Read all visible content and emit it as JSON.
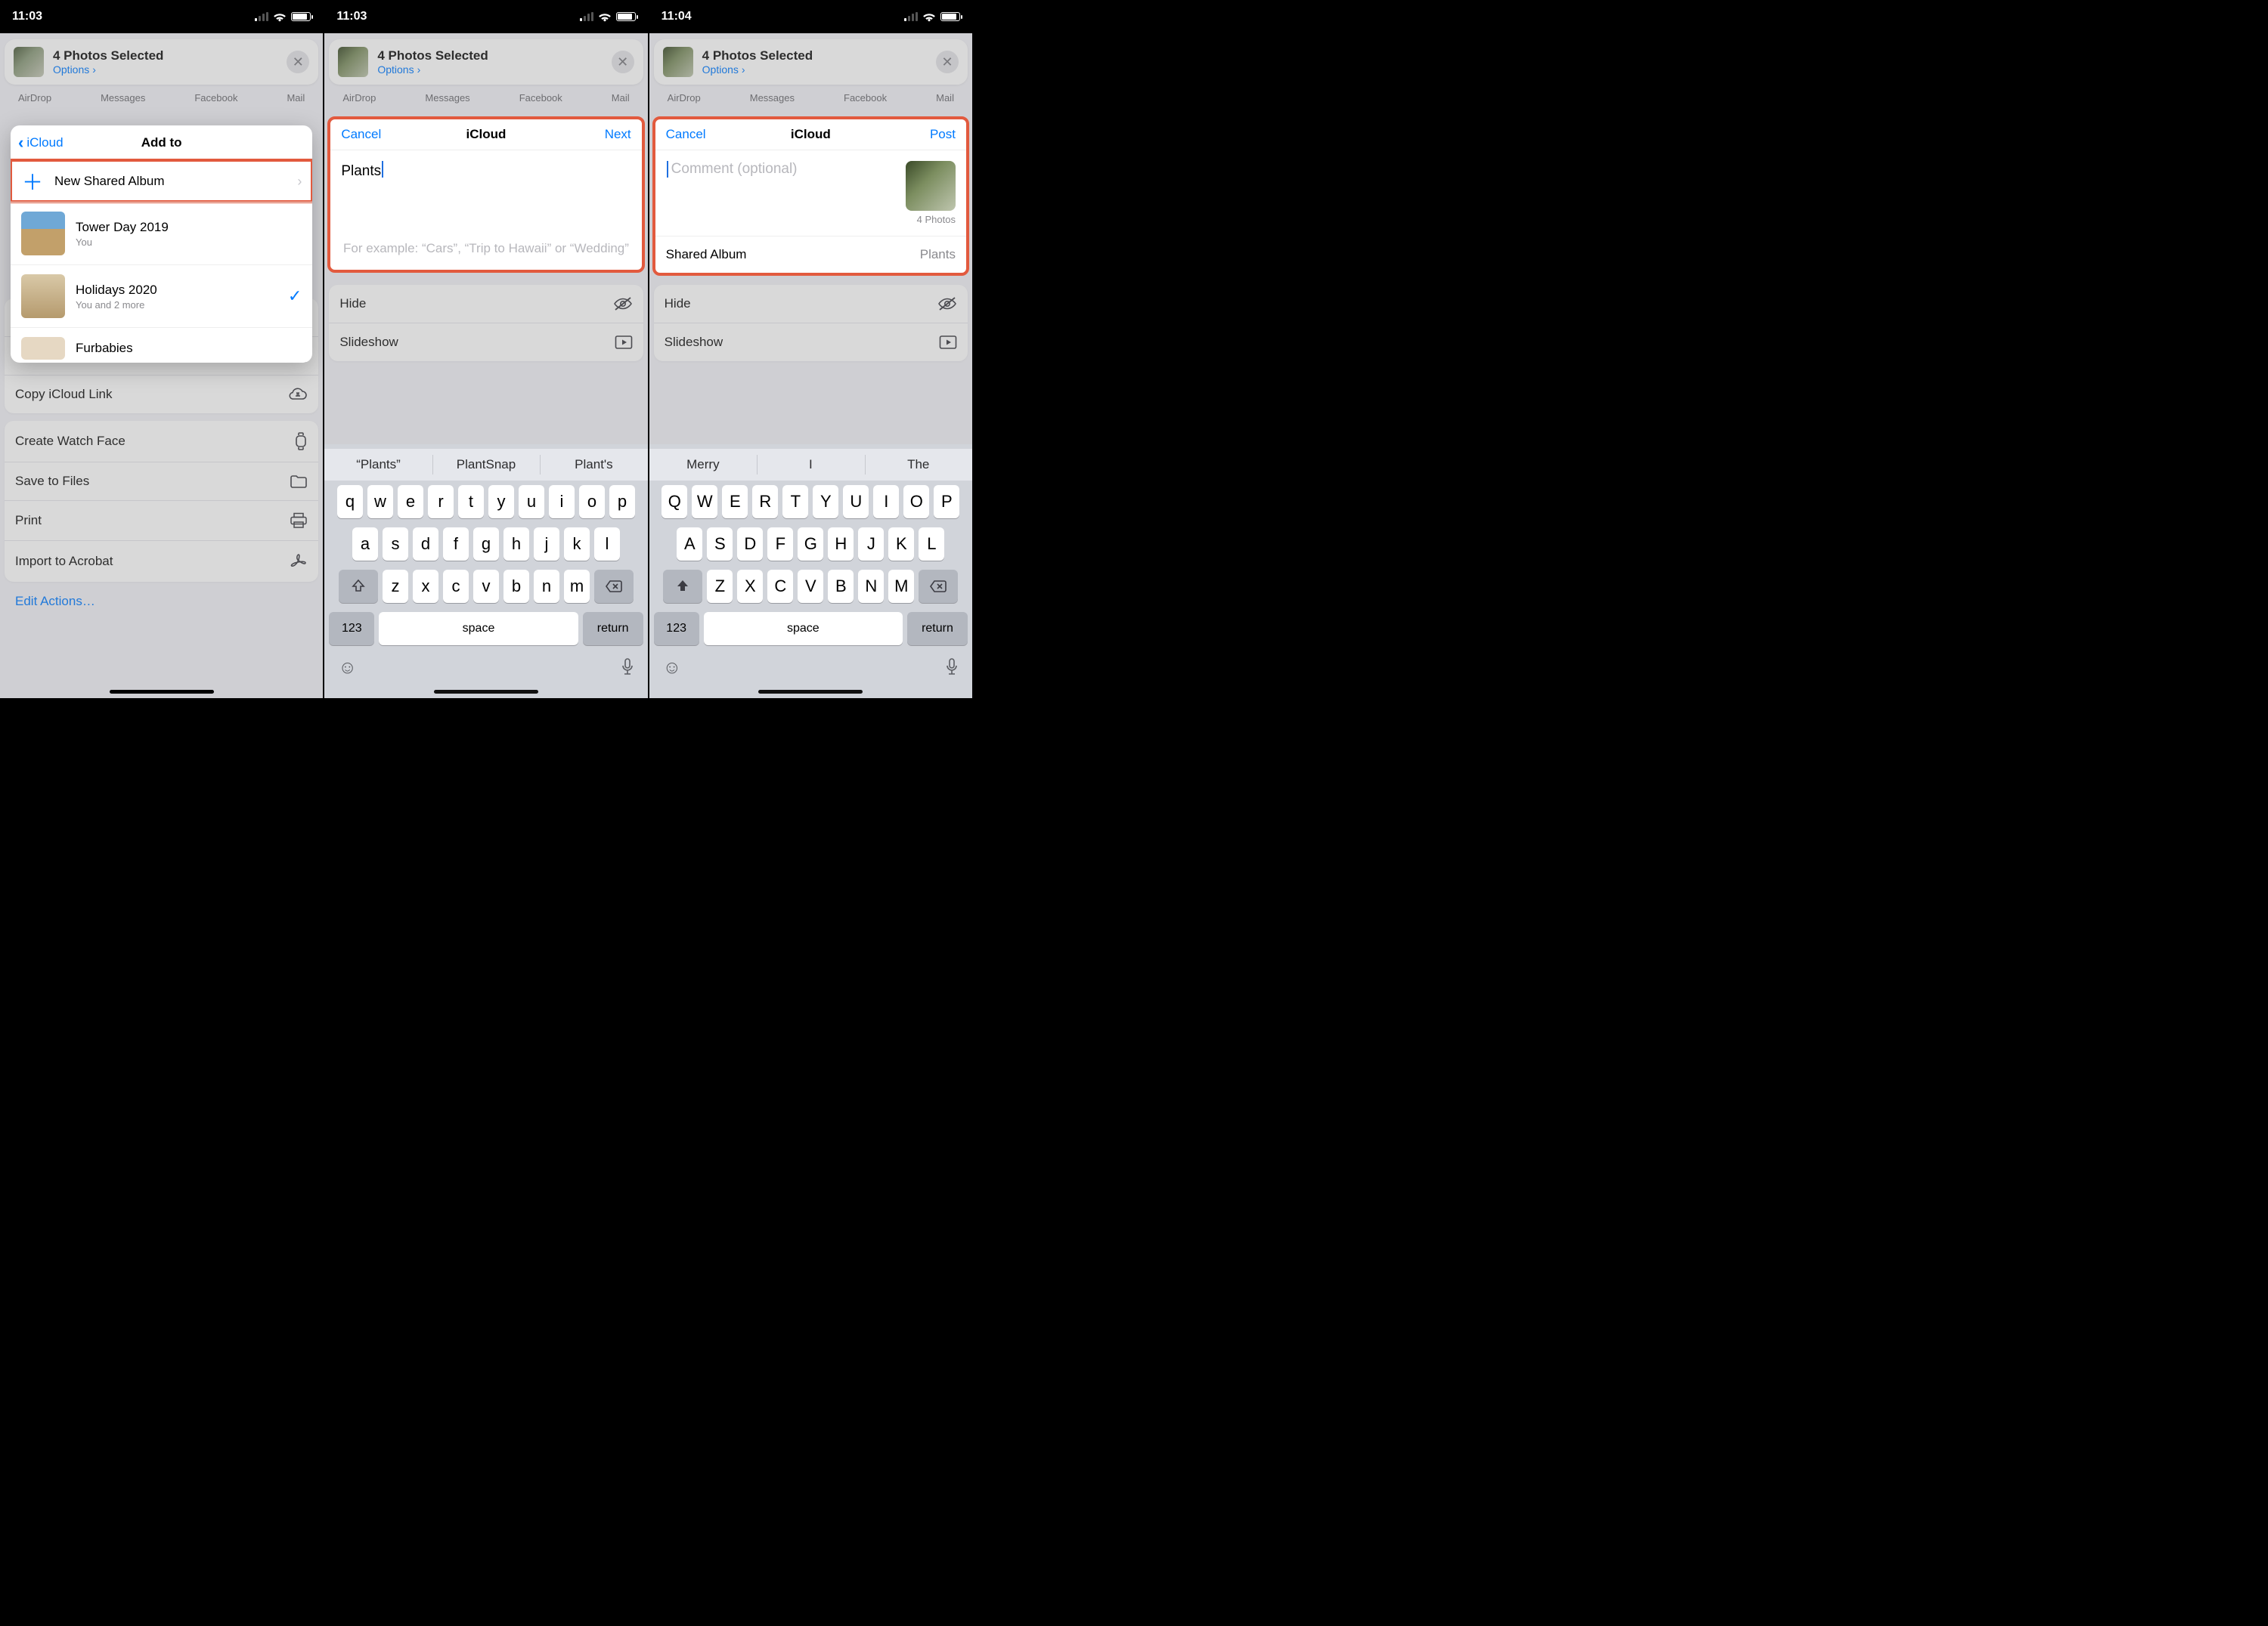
{
  "status": {
    "time1": "11:03",
    "time2": "11:03",
    "time3": "11:04"
  },
  "share": {
    "title": "4 Photos Selected",
    "options": "Options"
  },
  "apps": [
    "AirDrop",
    "Messages",
    "Facebook",
    "Mail"
  ],
  "actions1": {
    "hide": "Hide",
    "slideshow": "Slideshow",
    "copy": "Copy iCloud Link",
    "watch": "Create Watch Face",
    "save": "Save to Files",
    "print": "Print",
    "acro": "Import to Acrobat",
    "edit": "Edit Actions…"
  },
  "addto": {
    "back": "iCloud",
    "title": "Add to",
    "new": "New Shared Album",
    "albums": [
      {
        "title": "Tower Day 2019",
        "sub": "You"
      },
      {
        "title": "Holidays 2020",
        "sub": "You and 2 more",
        "checked": true
      },
      {
        "title": "Furbabies",
        "sub": ""
      }
    ]
  },
  "modal2": {
    "cancel": "Cancel",
    "title": "iCloud",
    "next": "Next",
    "value": "Plants",
    "hint": "For example: “Cars”, “Trip to Hawaii” or “Wedding”"
  },
  "modal3": {
    "cancel": "Cancel",
    "title": "iCloud",
    "post": "Post",
    "placeholder": "Comment (optional)",
    "count": "4 Photos",
    "salabel": "Shared Album",
    "savalue": "Plants"
  },
  "kbd2": {
    "sugg": [
      "“Plants”",
      "PlantSnap",
      "Plant's"
    ],
    "r1": [
      "q",
      "w",
      "e",
      "r",
      "t",
      "y",
      "u",
      "i",
      "o",
      "p"
    ],
    "r2": [
      "a",
      "s",
      "d",
      "f",
      "g",
      "h",
      "j",
      "k",
      "l"
    ],
    "r3": [
      "z",
      "x",
      "c",
      "v",
      "b",
      "n",
      "m"
    ],
    "num": "123",
    "space": "space",
    "ret": "return"
  },
  "kbd3": {
    "sugg": [
      "Merry",
      "I",
      "The"
    ],
    "r1": [
      "Q",
      "W",
      "E",
      "R",
      "T",
      "Y",
      "U",
      "I",
      "O",
      "P"
    ],
    "r2": [
      "A",
      "S",
      "D",
      "F",
      "G",
      "H",
      "J",
      "K",
      "L"
    ],
    "r3": [
      "Z",
      "X",
      "C",
      "V",
      "B",
      "N",
      "M"
    ],
    "num": "123",
    "space": "space",
    "ret": "return"
  }
}
